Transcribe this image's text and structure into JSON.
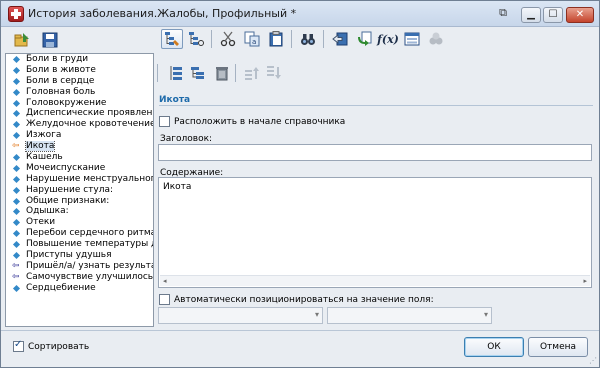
{
  "window": {
    "title": "История заболевания.Жалобы, Профильный *",
    "controls": [
      "restore",
      "minimize",
      "maximize",
      "close"
    ]
  },
  "left_toolbar": {
    "icons": [
      "folder-tree-icon",
      "save-icon"
    ]
  },
  "tree": {
    "items": [
      {
        "label": "Боли в груди",
        "marker": "diamond"
      },
      {
        "label": "Боли в животе",
        "marker": "diamond"
      },
      {
        "label": "Боли в сердце",
        "marker": "diamond"
      },
      {
        "label": "Головная боль",
        "marker": "diamond"
      },
      {
        "label": "Головокружение",
        "marker": "diamond"
      },
      {
        "label": "Диспепсические проявления:",
        "marker": "diamond"
      },
      {
        "label": "Желудочное кровотечение:",
        "marker": "diamond"
      },
      {
        "label": "Изжога",
        "marker": "diamond"
      },
      {
        "label": "Икота",
        "marker": "arrow-orange",
        "selected": true
      },
      {
        "label": "Кашель",
        "marker": "diamond"
      },
      {
        "label": "Мочеиспускание",
        "marker": "diamond"
      },
      {
        "label": "Нарушение менструального ...",
        "marker": "diamond"
      },
      {
        "label": "Нарушение стула:",
        "marker": "diamond"
      },
      {
        "label": "Общие признаки:",
        "marker": "diamond"
      },
      {
        "label": "Одышка:",
        "marker": "diamond"
      },
      {
        "label": "Отеки",
        "marker": "diamond"
      },
      {
        "label": "Перебои сердечного ритма:",
        "marker": "diamond"
      },
      {
        "label": "Повышение температуры до",
        "marker": "diamond"
      },
      {
        "label": "Приступы удушья",
        "marker": "diamond"
      },
      {
        "label": "Пришёл/а/  узнать результат...",
        "marker": "arrow-blue"
      },
      {
        "label": "Самочувствие улучшилось",
        "marker": "arrow-blue"
      },
      {
        "label": "Сердцебиение",
        "marker": "diamond"
      }
    ]
  },
  "right_toolbar": {
    "icons": [
      "tree-edit-icon",
      "tree-view-icon",
      "scissors-icon",
      "copy-text-icon",
      "paste-icon",
      "binoculars-icon",
      "import-icon",
      "refresh-icon",
      "function-icon",
      "form-icon",
      "group-icon"
    ],
    "function_label": "f(x)"
  },
  "sub_toolbar": {
    "icons": [
      "add-item-icon",
      "add-subitem-icon",
      "trash-icon",
      "move-up-icon",
      "move-down-icon"
    ]
  },
  "detail": {
    "title": "Икота",
    "place_at_start_label": "Расположить в начале справочника",
    "place_at_start_checked": false,
    "heading_label": "Заголовок:",
    "heading_value": "",
    "content_label": "Содержание:",
    "content_value": "Икота",
    "auto_position_label": "Автоматически позиционироваться на значение поля:",
    "auto_position_checked": false,
    "combo1_value": "",
    "combo2_value": ""
  },
  "footer": {
    "sort_label": "Сортировать",
    "sort_checked": true,
    "ok_label": "ОК",
    "cancel_label": "Отмена"
  }
}
